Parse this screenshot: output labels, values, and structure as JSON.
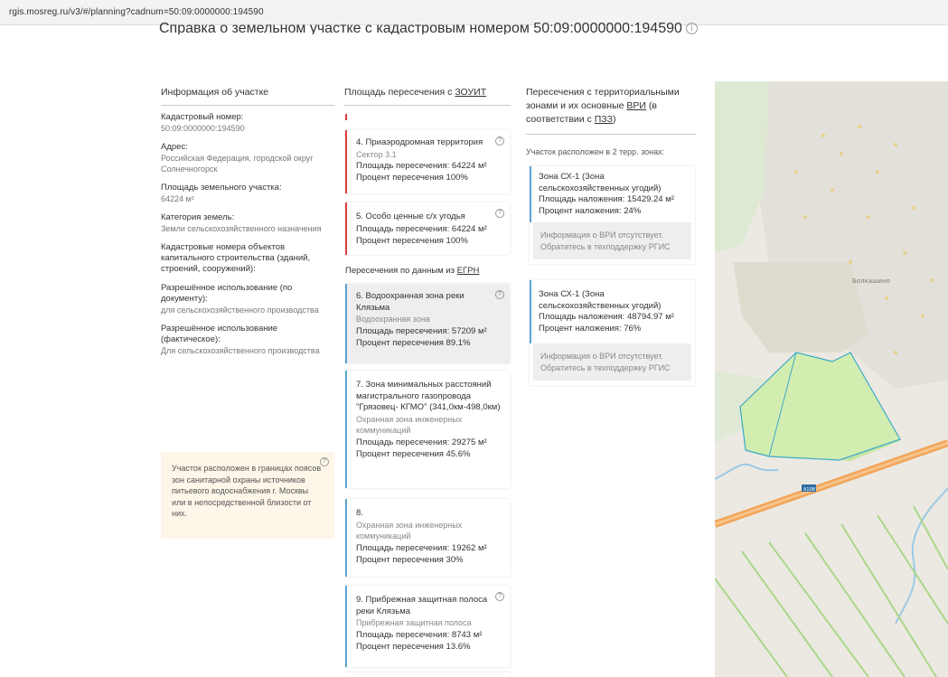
{
  "browser": {
    "url": "rgis.mosreg.ru/v3/#/planning?cadnum=50:09:0000000:194590"
  },
  "page": {
    "title": "Справка о земельном участке с кадастровым номером 50:09:0000000:194590"
  },
  "columns": {
    "info": {
      "heading": "Информация об участке"
    },
    "zouit": {
      "heading_prefix": "Площадь пересечения с ",
      "heading_link": "ЗОУИТ"
    },
    "zones": {
      "heading_line1": "Пересечения с территориальными",
      "heading_line2_prefix": "зонами и их основные ",
      "heading_line2_link": "ВРИ",
      "heading_line2_suffix": " (в",
      "heading_line3_prefix": "соответствии с ",
      "heading_line3_link": "ПЗЗ",
      "heading_line3_suffix": ")"
    }
  },
  "parcel": {
    "cad_label": "Кадастровый номер:",
    "cad_value": "50:09:0000000:194590",
    "addr_label": "Адрес:",
    "addr_value": "Российская Федерация, городской округ Солнечногорск",
    "area_label": "Площадь земельного участка:",
    "area_value": "64224 м²",
    "cat_label": "Категория земель:",
    "cat_value": "Земли сельскохозяйственного назначения",
    "oks_label": "Кадастровые номера объектов капитального строительства (зданий, строений, сооружений):",
    "use_doc_label": "Разрешённое использование (по документу):",
    "use_doc_value": "для сельскохозяйственного производства",
    "use_fact_label": "Разрешённое использование (фактическое):",
    "use_fact_value": "Для сельскохозяйственного производства",
    "warning": "Участок расположен в границах поясов зон санитарной охраны источников питьевого водоснабжения г. Москвы или в непосредственной близости от них."
  },
  "zouit_cards": [
    {
      "title": "4. Приаэродромная территория",
      "subtitle": "Сектор 3.1",
      "area": "Площадь пересечения: 64224 м²",
      "percent": "Процент пересечения 100%"
    },
    {
      "title": "5. Особо ценные с/х угодья",
      "subtitle": "",
      "area": "Площадь пересечения: 64224 м²",
      "percent": "Процент пересечения 100%"
    }
  ],
  "egrn": {
    "heading_prefix": "Пересечения по данным из ",
    "heading_link": "ЕГРН"
  },
  "egrn_cards": [
    {
      "title": "6. Водоохранная зона реки Клязьма",
      "subtitle": "Водоохранная зона",
      "area": "Площадь пересечения: 57209 м²",
      "percent": "Процент пересечения 89.1%"
    },
    {
      "title": "7. Зона минимальных расстояний магистрального газопровода \"Грязовец- КГМО\" (341,0км-498,0км)",
      "subtitle": "Охранная зона инженерных коммуникаций",
      "area": "Площадь пересечения: 29275 м²",
      "percent": "Процент пересечения 45.6%"
    },
    {
      "title": "8.",
      "subtitle": "Охранная зона инженерных коммуникаций",
      "area": "Площадь пересечения: 19262 м²",
      "percent": "Процент пересечения 30%"
    },
    {
      "title": "9. Прибрежная защитная полоса реки Клязьма",
      "subtitle": "Прибрежная защитная полоса",
      "area": "Площадь пересечения: 8743 м²",
      "percent": "Процент пересечения 13.6%"
    }
  ],
  "zones": {
    "note": "Участок расположен в 2 терр. зонах:",
    "items": [
      {
        "title": "Зона СХ-1 (Зона сельскохозяйственных угодий)",
        "area": "Площадь наложения: 15429.24 м²",
        "percent": "Процент наложения: 24%",
        "vri": "Информация о ВРИ отсутствует. Обратитесь в техподдержку РГИС"
      },
      {
        "title": "Зона СХ-1 (Зона сельскохозяйственных угодий)",
        "area": "Площадь наложения: 48794.97 м²",
        "percent": "Процент наложения: 76%",
        "vri": "Информация о ВРИ отсутствует. Обратитесь в техподдержку РГИС"
      }
    ]
  },
  "map": {
    "place_label": "Болкашино",
    "road_label": "А108"
  },
  "colors": {
    "accent_red": "#e23b3b",
    "accent_blue": "#5aa6d6",
    "warn_bg": "#fdf6e9"
  }
}
